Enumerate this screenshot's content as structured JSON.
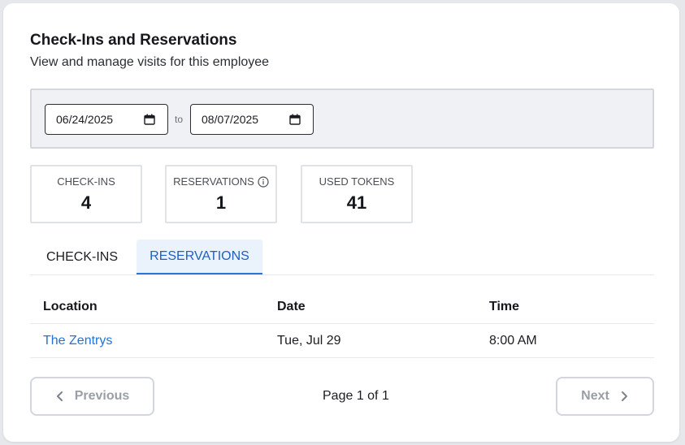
{
  "header": {
    "title": "Check-Ins and Reservations",
    "subtitle": "View and manage visits for this employee"
  },
  "filters": {
    "start_date": "06/24/2025",
    "to_label": "to",
    "end_date": "08/07/2025",
    "calendar_icon": "calendar-icon"
  },
  "stats": [
    {
      "label": "CHECK-INS",
      "value": "4"
    },
    {
      "label": "RESERVATIONS",
      "value": "1",
      "icon": "info-icon"
    },
    {
      "label": "USED TOKENS",
      "value": "41"
    }
  ],
  "tabs": [
    {
      "label": "CHECK-INS",
      "active": false
    },
    {
      "label": "RESERVATIONS",
      "active": true
    }
  ],
  "table": {
    "columns": [
      "Location",
      "Date",
      "Time"
    ],
    "rows": [
      {
        "location": "The Zentrys",
        "date": "Tue, Jul 29",
        "time": "8:00 AM"
      }
    ]
  },
  "pagination": {
    "previous_label": "Previous",
    "page_info": "Page 1 of 1",
    "next_label": "Next"
  },
  "colors": {
    "accent": "#1f5fc4",
    "link": "#2473d6",
    "active_tab_bg": "#eaf3fc"
  }
}
